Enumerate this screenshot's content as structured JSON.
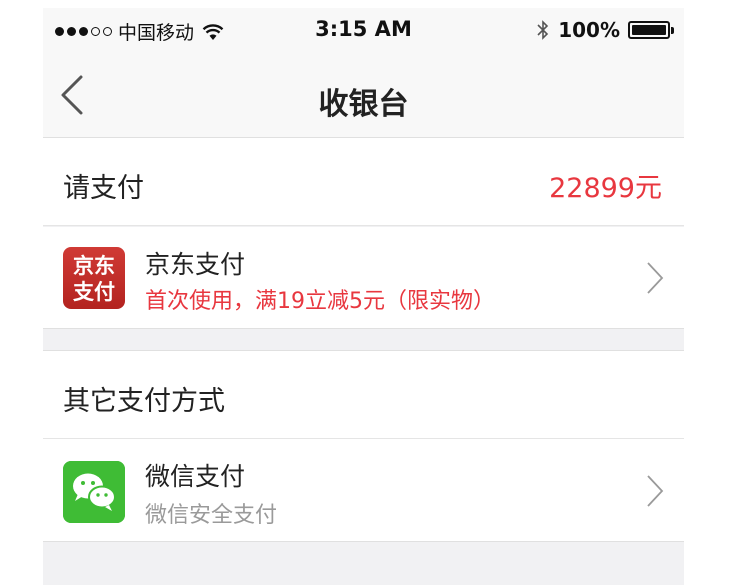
{
  "status_bar": {
    "carrier": "中国移动",
    "time": "3:15 AM",
    "battery": "100%"
  },
  "nav": {
    "title": "收银台"
  },
  "payment_due": {
    "label": "请支付",
    "amount": "22899元"
  },
  "jd_pay": {
    "logo_line1": "京东",
    "logo_line2": "支付",
    "title": "京东支付",
    "subtitle": "首次使用，满19立减5元（限实物）"
  },
  "other_methods": {
    "label": "其它支付方式"
  },
  "wechat_pay": {
    "title": "微信支付",
    "subtitle": "微信安全支付"
  },
  "colors": {
    "accent_red": "#e8373f",
    "wechat_green": "#3fbc35",
    "jd_red": "#c52e29"
  }
}
